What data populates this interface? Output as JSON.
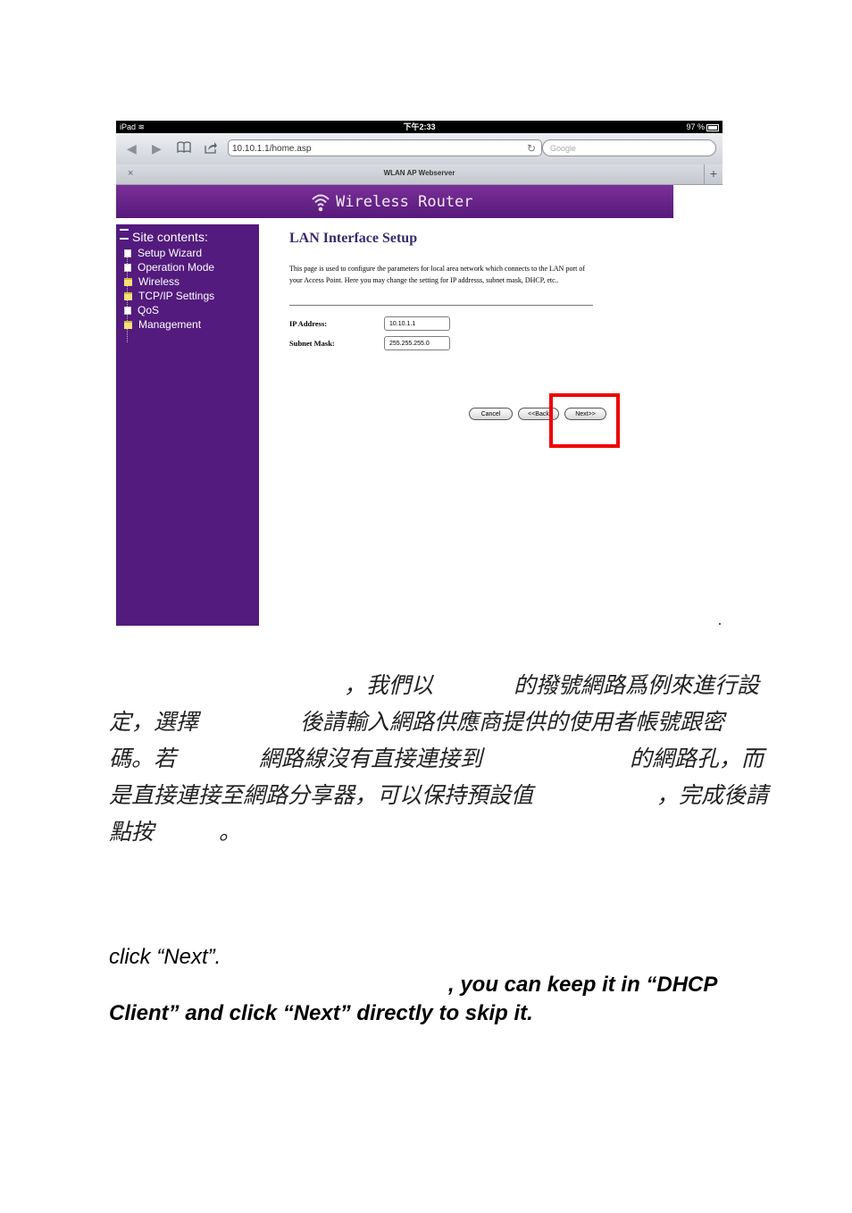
{
  "statusbar": {
    "device": "iPad",
    "time": "下午2:33",
    "battery": "97 %"
  },
  "browser": {
    "url": "10.10.1.1/home.asp",
    "search_placeholder": "Google",
    "tab_close": "×",
    "tab_title": "WLAN AP Webserver",
    "tab_add": "+"
  },
  "banner": {
    "title": "Wireless Router"
  },
  "sidebar": {
    "heading": "Site contents:",
    "items": [
      {
        "label": "Setup Wizard",
        "icon": "document-icon"
      },
      {
        "label": "Operation Mode",
        "icon": "document-icon"
      },
      {
        "label": "Wireless",
        "icon": "folder-icon"
      },
      {
        "label": "TCP/IP Settings",
        "icon": "folder-icon"
      },
      {
        "label": "QoS",
        "icon": "document-icon"
      },
      {
        "label": "Management",
        "icon": "folder-icon"
      }
    ]
  },
  "main": {
    "title": "LAN Interface Setup",
    "description": "This page is used to configure the parameters for local area network which connects to the LAN port of your Access Point. Here you may change the setting for IP addresss, subnet mask, DHCP, etc..",
    "ip_label": "IP Address:",
    "ip_value": "10.10.1.1",
    "mask_label": "Subnet Mask:",
    "mask_value": "255.255.255.0",
    "buttons": {
      "cancel": "Cancel",
      "back": "<<Back",
      "next": "Next>>"
    }
  },
  "doc": {
    "zh_lines": [
      "，我們以的撥號網路爲例來進行設",
      "定，選擇後請輸入網路供應商提供的使用者帳號跟密",
      "碼。若網路線沒有直接連接到的網路孔，而",
      "是直接連接至網路分享器，可以保持預設值，完成後請",
      "點按。"
    ],
    "zh_fragments": {
      "l1a": "，我們以",
      "l1b": "的撥號網路爲例來進行設",
      "l2a": "定，選擇",
      "l2b": "後請輸入網路供應商提供的使用者帳號跟密",
      "l3a": "碼。若",
      "l3b": "網路線沒有直接連接到",
      "l3c": "的網路孔，而",
      "l4a": "是直接連接至網路分享器，可以保持預設值",
      "l4b": "，完成後請",
      "l5a": "點按",
      "l5b": "。"
    },
    "en_line1": "click “Next”.",
    "en_line2": ", you can keep it in “DHCP",
    "en_line3": "Client” and click “Next” directly to skip it."
  }
}
